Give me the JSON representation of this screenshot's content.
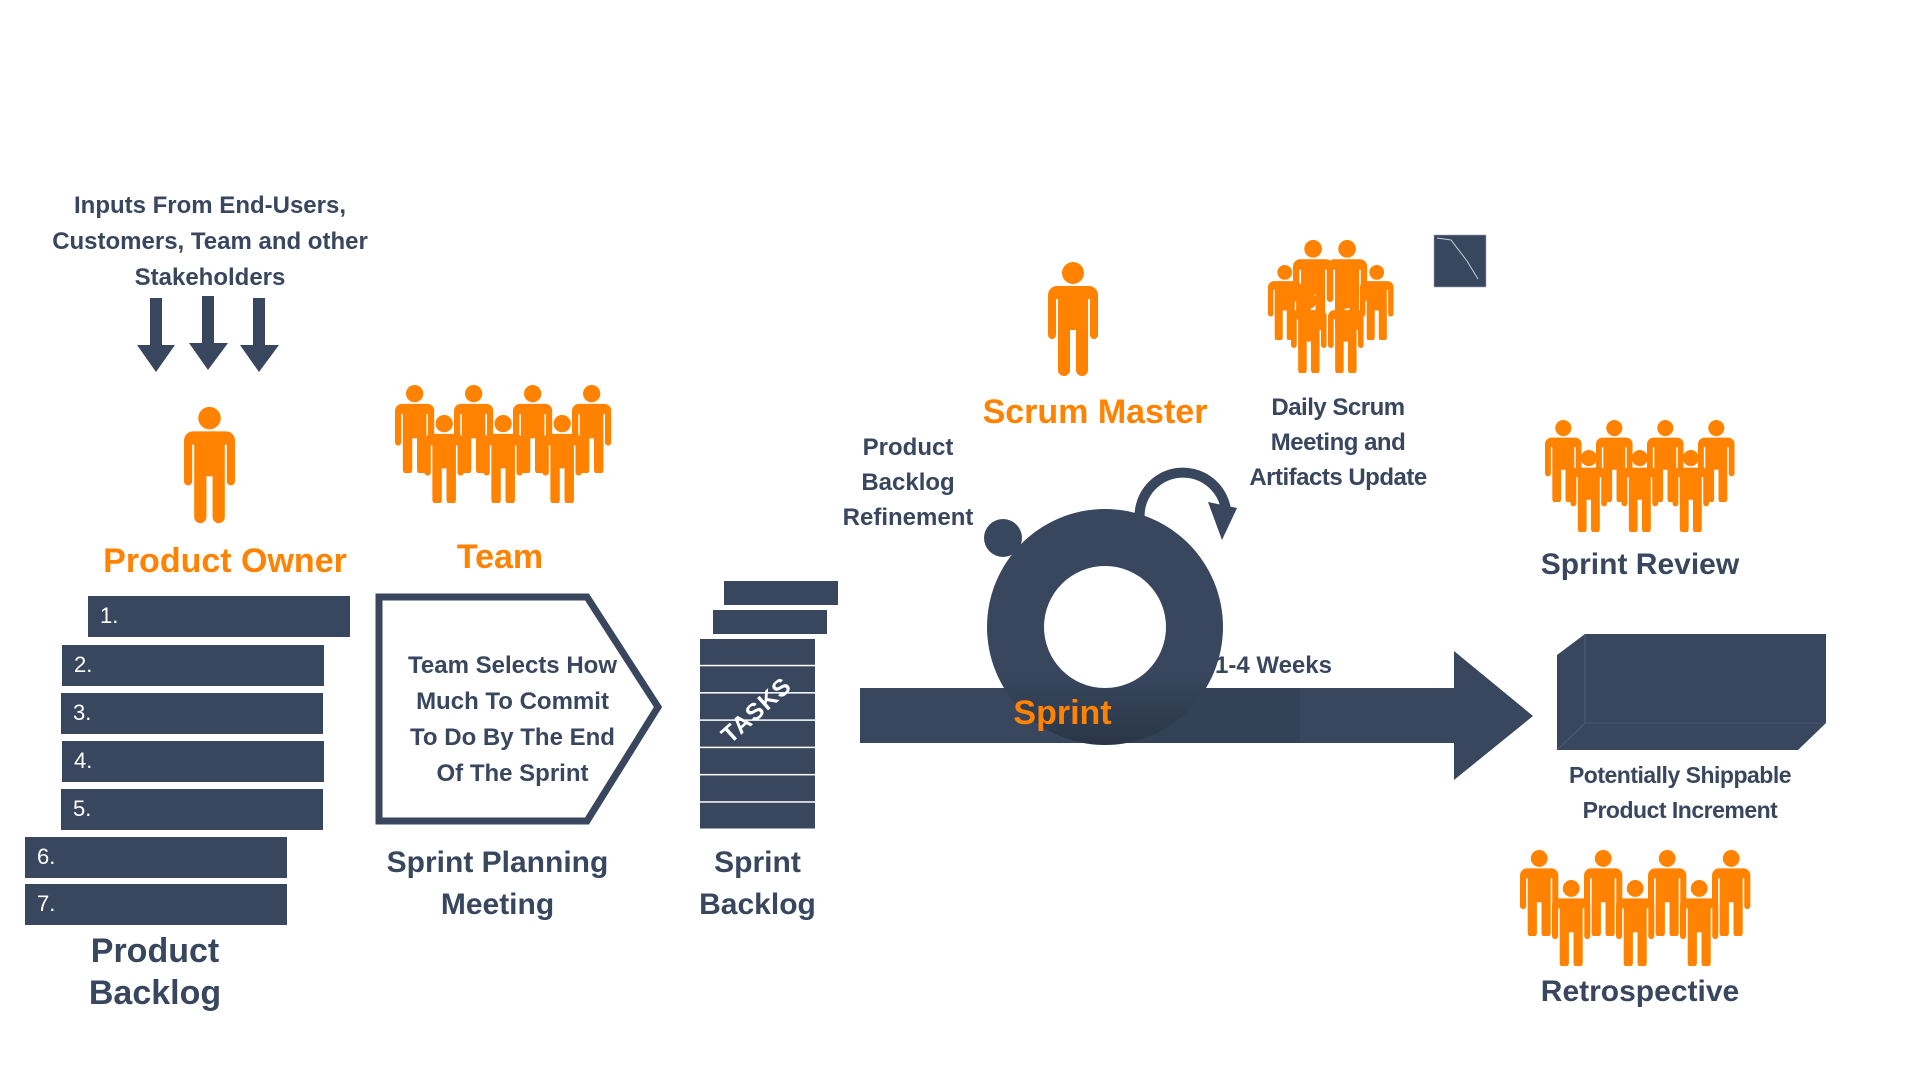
{
  "colors": {
    "navy": "#38475e",
    "orange": "#ff8200",
    "background": "#ffffff"
  },
  "inputs": {
    "text": "Inputs From End-Users,\nCustomers, Team and other\nStakeholders",
    "arrow_count": 3,
    "icon": "down-arrow-icon"
  },
  "roles": {
    "product_owner": {
      "label": "Product Owner",
      "icon": "person-icon",
      "people": 1
    },
    "team": {
      "label": "Team",
      "icon": "group-icon",
      "people": 7
    },
    "scrum_master": {
      "label": "Scrum Master",
      "icon": "person-icon",
      "people": 1
    }
  },
  "product_backlog": {
    "label": "Product\nBacklog",
    "items": [
      "1.",
      "2.",
      "3.",
      "4.",
      "5.",
      "6.",
      "7."
    ]
  },
  "sprint_planning": {
    "box_text": "Team Selects How\nMuch To Commit\nTo Do By The End\nOf The Sprint",
    "label": "Sprint Planning\nMeeting"
  },
  "sprint_backlog": {
    "stack_label": "TASKS",
    "label": "Sprint\nBacklog",
    "task_rows": 7
  },
  "sprint": {
    "label": "Sprint",
    "duration": "1-4 Weeks",
    "refinement_label": "Product\nBacklog\nRefinement",
    "daily_label": "Daily Scrum\nMeeting and\nArtifacts Update",
    "daily_people": 6
  },
  "outputs": {
    "increment_label": "Potentially Shippable\nProduct Increment",
    "review_label": "Sprint Review",
    "review_people": 7,
    "retro_label": "Retrospective",
    "retro_people": 7
  }
}
